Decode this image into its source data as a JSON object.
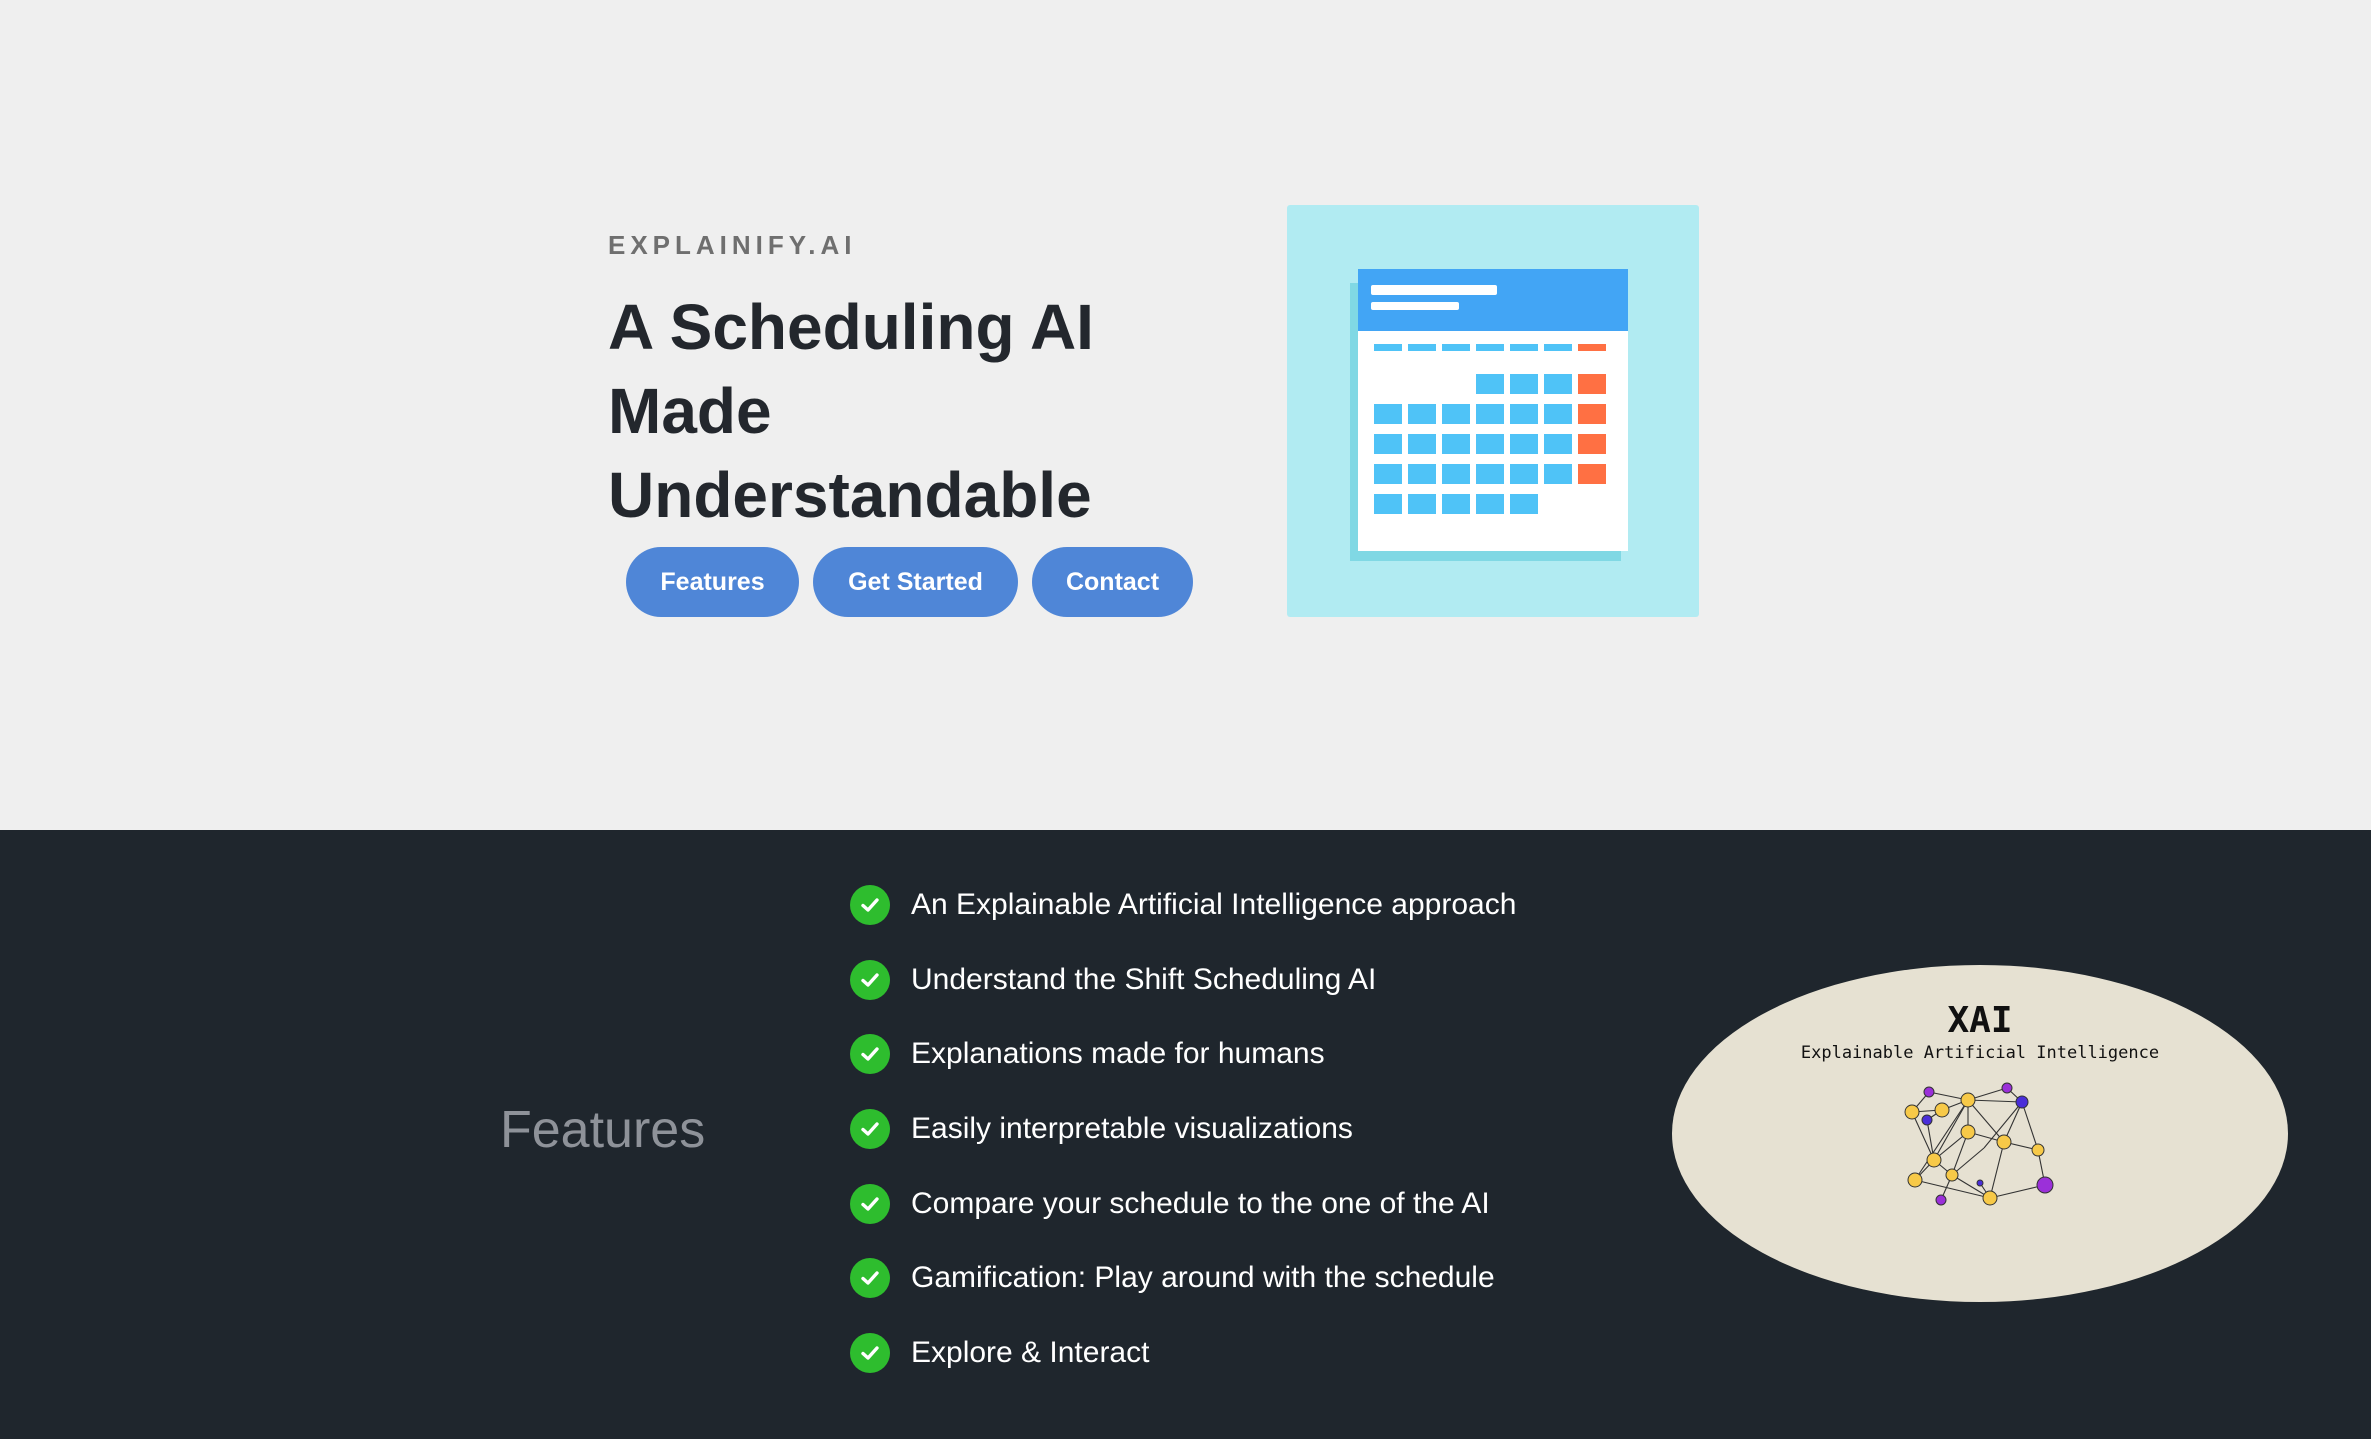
{
  "hero": {
    "brand": "EXPLAINIFY.AI",
    "headline": "A Scheduling AI Made Understandable",
    "buttons": {
      "features": "Features",
      "get_started": "Get Started",
      "contact": "Contact"
    },
    "illustration_icon": "calendar-icon"
  },
  "features": {
    "title": "Features",
    "items": [
      "An Explainable Artificial Intelligence approach",
      "Understand the Shift Scheduling AI",
      "Explanations made for humans",
      "Easily interpretable visualizations",
      "Compare your schedule to the one of the AI",
      "Gamification: Play around with the schedule",
      "Explore & Interact"
    ],
    "item_icon": "checkmark-icon",
    "xai": {
      "title": "XAI",
      "subtitle": "Explainable Artificial Intelligence",
      "icon": "neural-network-icon"
    }
  },
  "colors": {
    "hero_bg": "#efefef",
    "features_bg": "#1f262d",
    "button": "#4f86d7",
    "check": "#2ebd2e",
    "calendar_header": "#42a5f5",
    "calendar_cell": "#4fc3f7",
    "calendar_weekend": "#ff7043",
    "illustration_bg": "#b1ebf2"
  }
}
